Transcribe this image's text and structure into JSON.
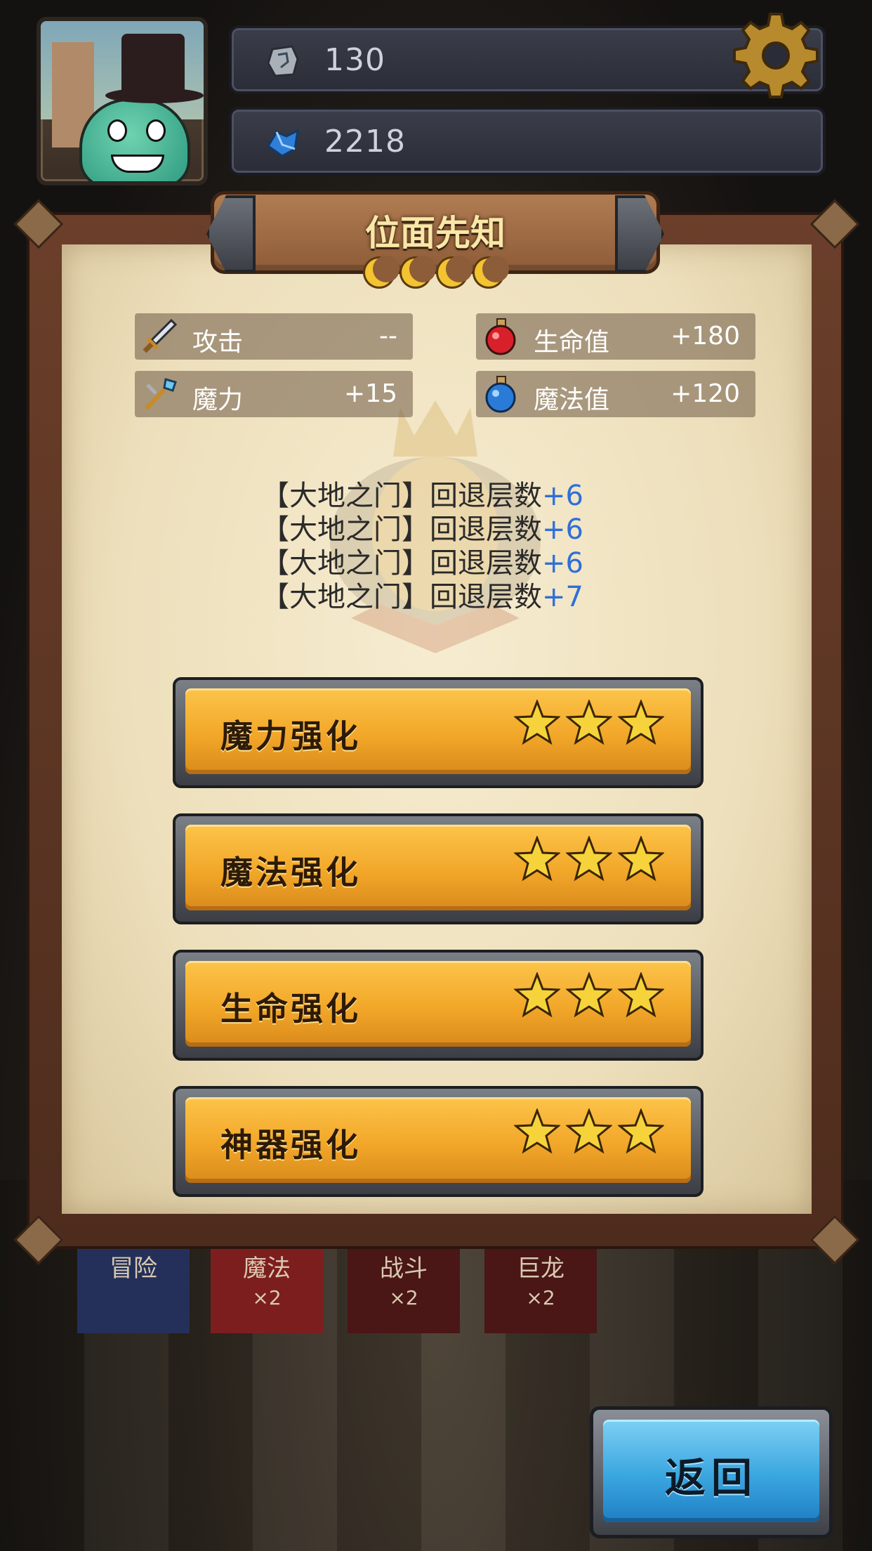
{
  "resources": [
    {
      "icon": "rune-stone-icon",
      "value": "130"
    },
    {
      "icon": "blue-crystal-icon",
      "value": "2218"
    }
  ],
  "panel": {
    "title": "位面先知",
    "moons": 4,
    "stats": [
      {
        "icon": "sword-icon",
        "label": "攻击",
        "value": "--"
      },
      {
        "icon": "red-potion-icon",
        "label": "生命值",
        "value": "+180"
      },
      {
        "icon": "magic-staff-icon",
        "label": "魔力",
        "value": "+15"
      },
      {
        "icon": "blue-potion-icon",
        "label": "魔法值",
        "value": "+120"
      }
    ],
    "descriptions": [
      {
        "text": "【大地之门】回退层数",
        "bonus": "+6"
      },
      {
        "text": "【大地之门】回退层数",
        "bonus": "+6"
      },
      {
        "text": "【大地之门】回退层数",
        "bonus": "+6"
      },
      {
        "text": "【大地之门】回退层数",
        "bonus": "+7"
      }
    ],
    "upgrades": [
      {
        "label": "魔力强化",
        "stars": 3
      },
      {
        "label": "魔法强化",
        "stars": 3
      },
      {
        "label": "生命强化",
        "stars": 3
      },
      {
        "label": "神器强化",
        "stars": 3
      }
    ]
  },
  "background_banners": [
    {
      "title": "冒险",
      "sub": ""
    },
    {
      "title": "魔法",
      "sub": "×2"
    },
    {
      "title": "战斗",
      "sub": "×2"
    },
    {
      "title": "巨龙",
      "sub": "×2"
    }
  ],
  "back_button": {
    "label": "返回"
  },
  "colors": {
    "bonus": "#2f6fd8",
    "button_orange": "#f2a729",
    "button_blue": "#3aa6e0",
    "title_gold": "#f8e7a6"
  }
}
